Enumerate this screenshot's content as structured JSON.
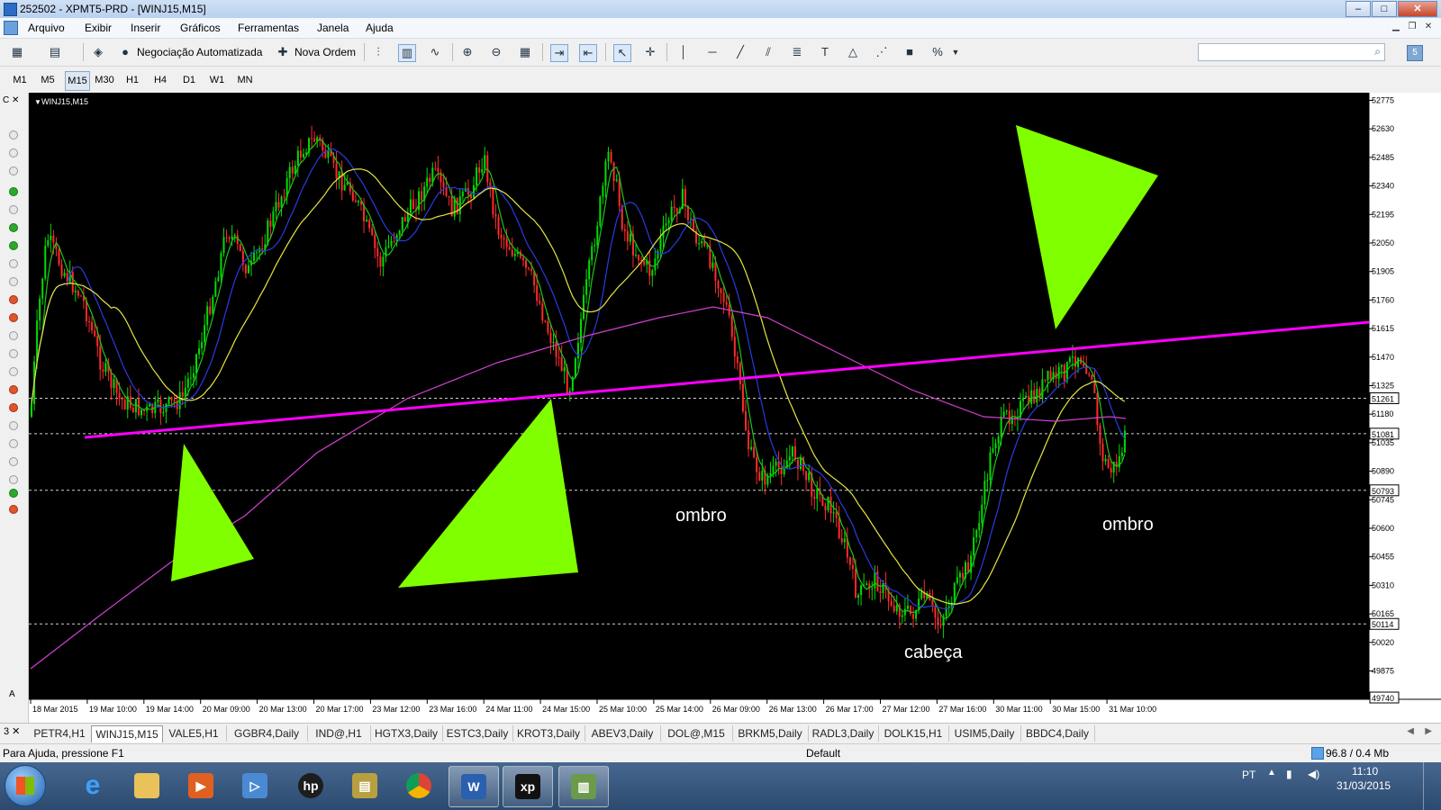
{
  "window": {
    "title": "252502 - XPMT5-PRD - [WINJ15,M15]",
    "minimize": "–",
    "maximize": "□",
    "close": "✕"
  },
  "menu": {
    "items": [
      "Arquivo",
      "Exibir",
      "Inserir",
      "Gráficos",
      "Ferramentas",
      "Janela",
      "Ajuda"
    ]
  },
  "toolbar": {
    "auto_trading": "Negociação Automatizada",
    "new_order": "Nova Ordem",
    "search_placeholder": ""
  },
  "timeframes": {
    "items": [
      "M1",
      "M5",
      "M15",
      "M30",
      "H1",
      "H4",
      "D1",
      "W1",
      "MN"
    ],
    "active": "M15"
  },
  "chart": {
    "symbol_label": "WINJ15,M15",
    "annotations": [
      "ombro",
      "ombro",
      "cabeça"
    ],
    "price_axis": [
      "52775",
      "52630",
      "52485",
      "52340",
      "52195",
      "52050",
      "51905",
      "51760",
      "51615",
      "51470",
      "51325",
      "51180",
      "51035",
      "50890",
      "50745",
      "50600",
      "50455",
      "50310",
      "50165",
      "50020",
      "49875"
    ],
    "level_labels": [
      "51261",
      "51081",
      "50793",
      "50114",
      "49740"
    ],
    "time_axis": [
      "18 Mar 2015",
      "19 Mar 10:00",
      "19 Mar 14:00",
      "20 Mar 09:00",
      "20 Mar 13:00",
      "20 Mar 17:00",
      "23 Mar 12:00",
      "23 Mar 16:00",
      "24 Mar 11:00",
      "24 Mar 15:00",
      "25 Mar 10:00",
      "25 Mar 14:00",
      "26 Mar 09:00",
      "26 Mar 13:00",
      "26 Mar 17:00",
      "27 Mar 12:00",
      "27 Mar 16:00",
      "30 Mar 11:00",
      "30 Mar 15:00",
      "31 Mar 10:00"
    ],
    "colors": {
      "background": "#000000",
      "bull": "#00dd00",
      "bear": "#ff2a2a",
      "ma_fast": "#18c818",
      "ma_mid": "#2a3ae0",
      "ma_slow": "#e6e640",
      "ma_long": "#d040d0",
      "trendline": "#ff00ff",
      "triangle": "#80ff00"
    }
  },
  "tabs": {
    "items": [
      "PETR4,H1",
      "WINJ15,M15",
      "VALE5,H1",
      "GGBR4,Daily",
      "IND@,H1",
      "HGTX3,Daily",
      "ESTC3,Daily",
      "KROT3,Daily",
      "ABEV3,Daily",
      "DOL@,M15",
      "BRKM5,Daily",
      "RADL3,Daily",
      "DOLK15,H1",
      "USIM5,Daily",
      "BBDC4,Daily"
    ],
    "active": "WINJ15,M15"
  },
  "status": {
    "help": "Para Ajuda, pressione F1",
    "profile": "Default",
    "connection": "96.8 / 0.4 Mb"
  },
  "taskbar": {
    "language": "PT",
    "time": "11:10",
    "date": "31/03/2015",
    "apps": [
      "start",
      "internet-explorer",
      "file-explorer",
      "media-player",
      "remote-desktop",
      "hp",
      "archive",
      "chrome",
      "word",
      "xp",
      "metatrader"
    ]
  }
}
